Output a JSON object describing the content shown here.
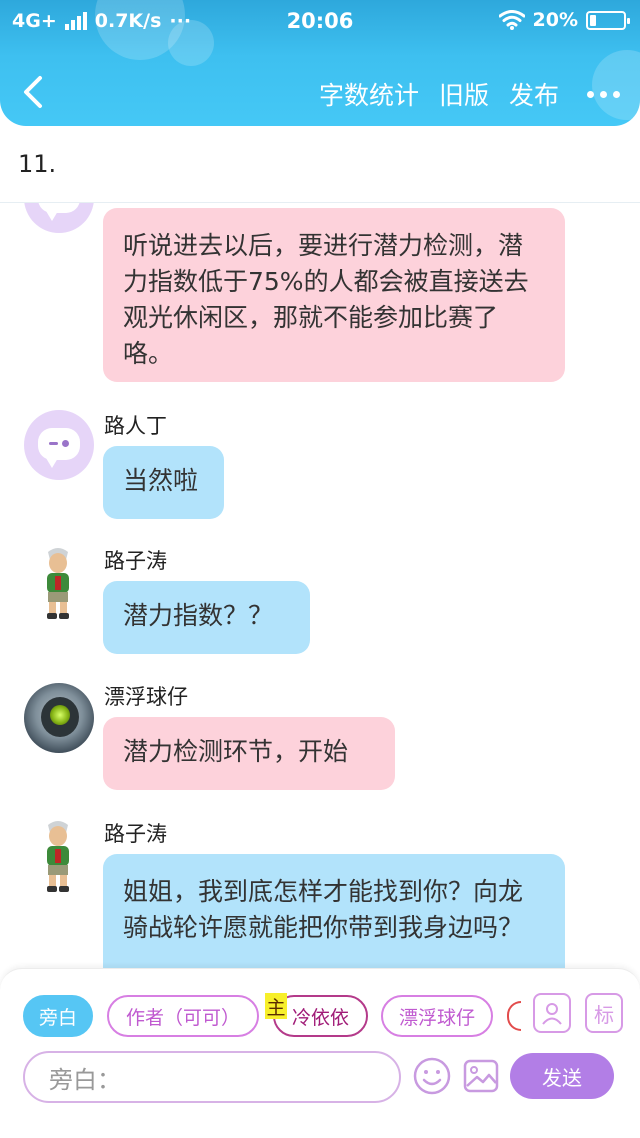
{
  "status_bar": {
    "network": "4G+",
    "speed": "0.7K/s",
    "dots": "···",
    "time": "20:06",
    "battery": "20%",
    "battery_level": 0.2
  },
  "nav": {
    "word_count": "字数统计",
    "old_version": "旧版",
    "publish": "发布"
  },
  "chapter_label": "11.",
  "messages": [
    {
      "speaker": "",
      "text": "听说进去以后，要进行潜力检测，潜力指数低于75%的人都会被直接送去观光休闲区，那就不能参加比赛了咯。",
      "color": "pink"
    },
    {
      "speaker": "路人丁",
      "text": "当然啦",
      "color": "blue"
    },
    {
      "speaker": "路子涛",
      "text": "潜力指数？？",
      "color": "blue"
    },
    {
      "speaker": "漂浮球仔",
      "text": "潜力检测环节，开始",
      "color": "pink"
    },
    {
      "speaker": "路子涛",
      "text": "姐姐，我到底怎样才能找到你？向龙骑战轮许愿就能把你带到我身边吗？",
      "color": "blue"
    }
  ],
  "roles": {
    "narration": "旁白",
    "author": "作者（可可）",
    "main_badge": "主",
    "lead": "冷依依",
    "float": "漂浮球仔",
    "tag_button": "标"
  },
  "composer": {
    "placeholder": "旁白：",
    "send": "发送"
  }
}
